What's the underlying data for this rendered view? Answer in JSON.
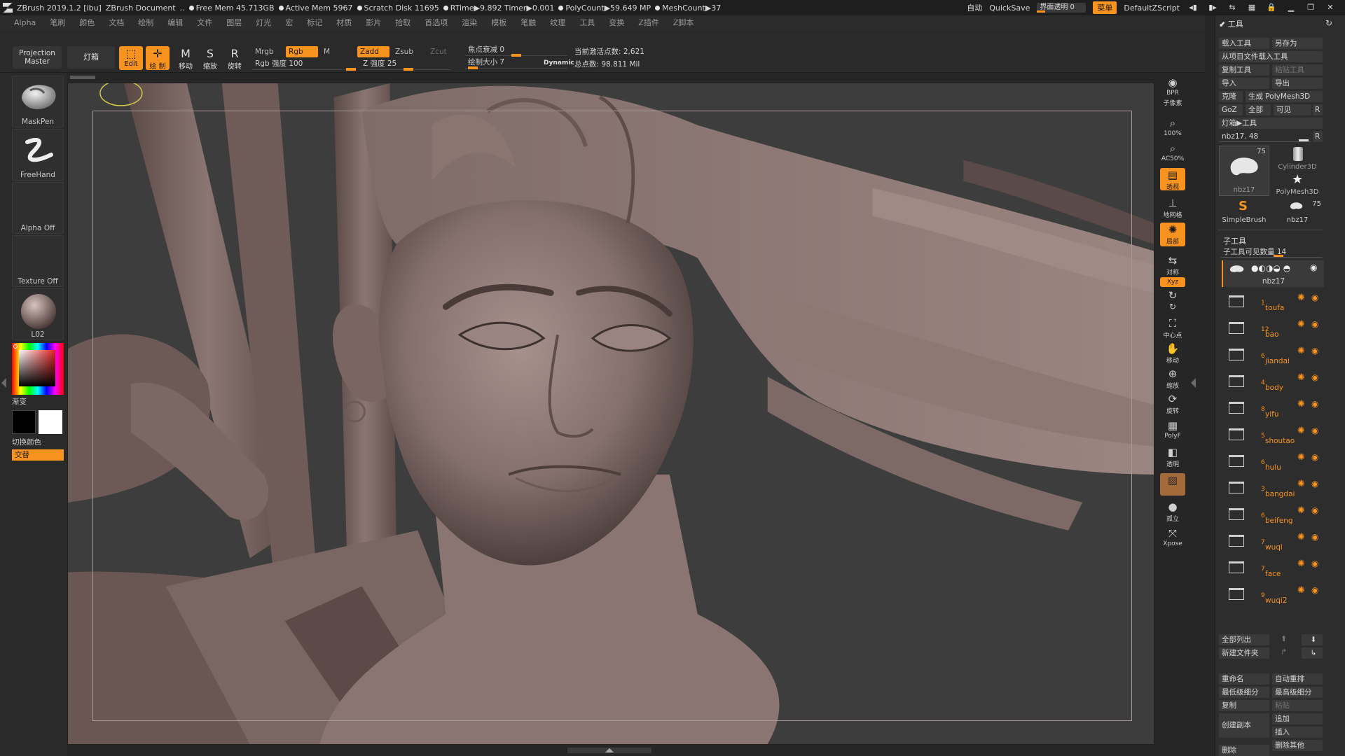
{
  "titlebar": {
    "app": "ZBrush 2019.1.2 [ibu]",
    "document": "ZBrush Document",
    "free_mem": "Free Mem 45.713GB",
    "active_mem": "Active Mem 5967",
    "scratch_disk": "Scratch Disk 11695",
    "rtime": "RTime▶9.892 Timer▶0.001",
    "polycount": "PolyCount▶59.649 MP",
    "meshcount": "MeshCount▶37",
    "auto": "自动",
    "quicksave": "QuickSave",
    "ui_opacity": "界面透明 0",
    "menu": "菜单",
    "script": "DefaultZScript"
  },
  "menubar": [
    "Alpha",
    "笔刷",
    "颜色",
    "文档",
    "绘制",
    "编辑",
    "文件",
    "图层",
    "灯光",
    "宏",
    "标记",
    "材质",
    "影片",
    "拾取",
    "首选项",
    "渲染",
    "模板",
    "笔触",
    "纹理",
    "工具",
    "变换",
    "Z插件",
    "Z脚本"
  ],
  "toolbar": {
    "projection_master": "Projection Master",
    "lightbox": "灯箱",
    "edit": "Edit",
    "draw": "绘 制",
    "move": "移动",
    "scale": "缩放",
    "rotate": "旋转",
    "mrgb": "Mrgb",
    "rgb": "Rgb",
    "m": "M",
    "rgb_intensity": "Rgb 强度 100",
    "zadd": "Zadd",
    "zsub": "Zsub",
    "zcut": "Zcut",
    "z_intensity": "Z 强度 25",
    "focal_shift": "焦点衰减 0",
    "draw_size": "绘制大小 7",
    "dynamic": "Dynamic",
    "active_points": "当前激活点数: 2,621",
    "total_points": "总点数: 98.811 Mil"
  },
  "leftshelf": {
    "brush1": "MaskPen",
    "brush2": "FreeHand",
    "alpha": "Alpha Off",
    "texture": "Texture Off",
    "material": "L02",
    "gradient": "渐变",
    "switch_color": "切换颜色",
    "alternate": "交替"
  },
  "rightstrip": {
    "bpr": "BPR",
    "subpixel": "子像素",
    "zoom100": "100%",
    "ac50": "AC50%",
    "persp": "透视",
    "floor": "地网格",
    "local": "局部",
    "sym": "对称",
    "xyz": "Xyz",
    "center": "中心点",
    "move": "移动",
    "scale": "缩放",
    "rotate": "旋转",
    "polyf": "PolyF",
    "transp": "透明",
    "ghost": "孤立",
    "xpose": "Xpose"
  },
  "toolpanel": {
    "title": "工具",
    "load_tool": "载入工具",
    "save_as": "另存为",
    "load_from_project": "从项目文件载入工具",
    "copy_tool": "复制工具",
    "paste_tool": "粘贴工具",
    "import": "导入",
    "export": "导出",
    "clone": "克隆",
    "make_polymesh": "生成 PolyMesh3D",
    "goz": "GoZ",
    "all": "全部",
    "visible": "可见",
    "r": "R",
    "lightbox_tools": "灯箱▶工具",
    "current_tool": "nbz17. 48",
    "thumb_count": "75",
    "thumbs": [
      "nbz17",
      "Cylinder3D",
      "PolyMesh3D",
      "SimpleBrush",
      "nbz17"
    ],
    "subtool_title": "子工具",
    "visible_count": "子工具可见数量 14",
    "active_subtool": "nbz17",
    "subtools": [
      {
        "num": "1",
        "name": "toufa"
      },
      {
        "num": "12",
        "name": "bao"
      },
      {
        "num": "6",
        "name": "jiandai"
      },
      {
        "num": "4",
        "name": "body"
      },
      {
        "num": "8",
        "name": "yifu"
      },
      {
        "num": "5",
        "name": "shoutao"
      },
      {
        "num": "6",
        "name": "hulu"
      },
      {
        "num": "3",
        "name": "bangdai"
      },
      {
        "num": "6",
        "name": "beifeng"
      },
      {
        "num": "7",
        "name": "wuqi"
      },
      {
        "num": "7",
        "name": "face"
      },
      {
        "num": "9",
        "name": "wuqi2"
      }
    ],
    "list_all": "全部列出",
    "new_folder": "新建文件夹",
    "rename": "重命名",
    "auto_reorder": "自动重排",
    "lowest_subdiv": "最低级细分",
    "highest_subdiv": "最高级细分",
    "duplicate": "复制",
    "paste": "粘贴",
    "create_copy": "创建副本",
    "append": "追加",
    "insert": "插入",
    "delete": "删除",
    "delete_other": "删除其他"
  },
  "colors": {
    "accent": "#f7931e",
    "bg": "#262626",
    "panel": "#2d2d2d",
    "clay": "#8e7a78"
  }
}
